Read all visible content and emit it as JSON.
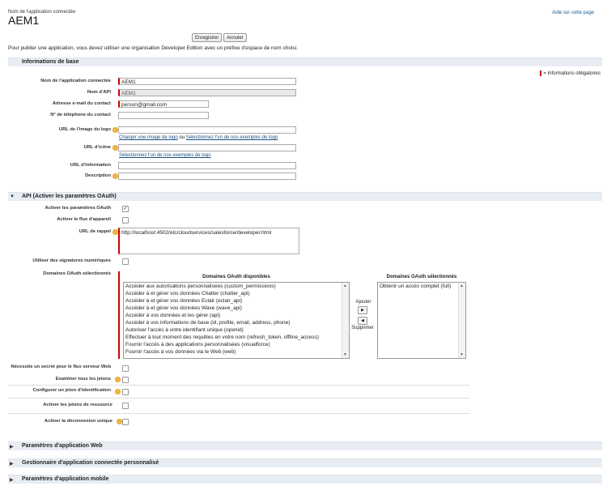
{
  "header": {
    "supertitle": "Nom de l'application connectée",
    "title": "AEM1",
    "help_link": "Aide sur cette page"
  },
  "toolbar": {
    "save_label": "Enregistrer",
    "cancel_label": "Annuler"
  },
  "intro_text": "Pour publier une application, vous devez utiliser une organisation Developer Edition avec un préfixe d'espace de nom choisi.",
  "basic_info": {
    "section_title": "Informations de base",
    "required_note": "= Informations obligatoires",
    "app_name_label": "Nom de l'application connectée",
    "app_name_value": "AEM1",
    "api_name_label": "Nom d'API",
    "api_name_value": "AEM1",
    "email_label": "Adresse e-mail du contact",
    "email_value": "person@gmail.com",
    "phone_label": "N° de téléphone du contact",
    "phone_value": "",
    "logo_url_label": "URL de l'image du logo",
    "logo_url_value": "",
    "logo_upload_link": "Charger une image de logo",
    "logo_or": "ou",
    "logo_sample_link": "Sélectionnez l'un de nos exemples de logo",
    "icon_url_label": "URL d'icône",
    "icon_url_value": "",
    "icon_sample_link": "Sélectionnez l'un de nos exemples de logo",
    "info_url_label": "URL d'information",
    "info_url_value": "",
    "description_label": "Description",
    "description_value": ""
  },
  "api": {
    "section_title": "API (Activer les paramètres OAuth)",
    "enable_oauth_label": "Activer les paramètres OAuth",
    "enable_oauth_checked": true,
    "device_flow_label": "Activer le flux d'appareil",
    "callback_url_label": "URL de rappel",
    "callback_url_value": "http://localhost:4502/etc/cloudservices/salesforce/developer.html",
    "digital_sig_label": "Utiliser des signatures numériques",
    "selected_scopes_label": "Domaines OAuth sélectionnés",
    "available_header": "Domaines OAuth disponibles",
    "selected_header": "Domaines OAuth sélectionnés",
    "available_scopes": [
      "Accéder aux autorisations personnalisées (custom_permissions)",
      "Accéder à et gérer vos données Chatter (chatter_api)",
      "Accéder à et gérer vos données Eclair (eclair_api)",
      "Accéder à et gérer vos données Wave (wave_api)",
      "Accéder à vos données et les gérer (api)",
      "Accéder à vos informations de base (id, profile, email, address, phone)",
      "Autoriser l'accès à votre identifiant unique (openid)",
      "Effectuer à tout moment des requêtes en votre nom (refresh_token, offline_access)",
      "Fournir l'accès à des applications personnalisées (visualforce)",
      "Fournir l'accès à vos données via le Web (web)"
    ],
    "selected_scopes": [
      "Obtenir un accès complet (full)"
    ],
    "add_label": "Ajouter",
    "remove_label": "Supprimer",
    "secret_required_label": "Nécessite un secret pour le flux serveur Web",
    "introspect_label": "Examiner tous les jetons",
    "id_token_label": "Configurer un jeton d'identification",
    "asset_tokens_label": "Activer les jetons de ressource",
    "single_logout_label": "Activer la déconnexion unique"
  },
  "collapsed_sections": [
    "Paramètres d'application Web",
    "Gestionnaire d'application connectée personnalisé",
    "Paramètres d'application mobile"
  ],
  "colors": {
    "section_bg": "#e8edf3",
    "required": "#cc0000",
    "link": "#1a4f80",
    "info_icon": "#f4b740"
  }
}
